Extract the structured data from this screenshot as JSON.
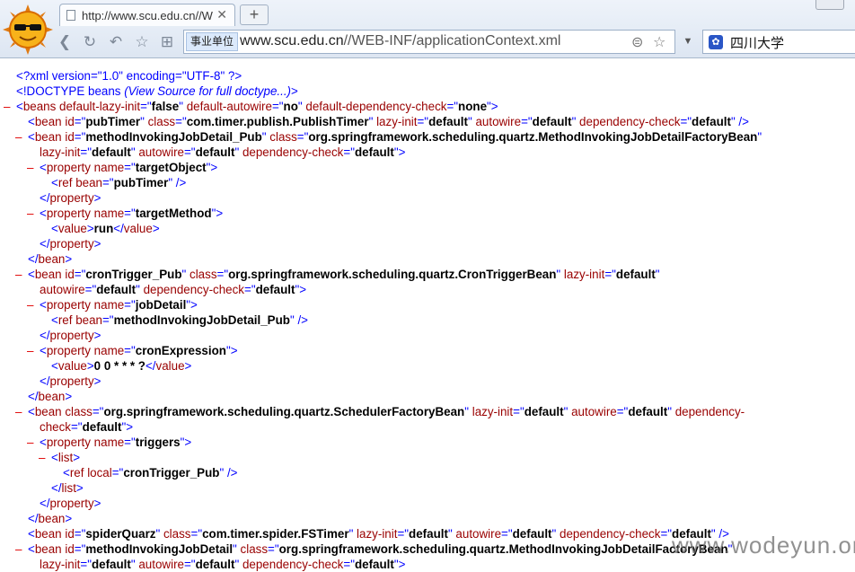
{
  "browser": {
    "tab_title": "http://www.scu.edu.cn//W",
    "tab_close": "✕",
    "new_tab": "+",
    "zone_badge": "事业单位",
    "url_host": "www.scu.edu.cn",
    "url_path": "//WEB-INF/applicationContext.xml",
    "search_text": "四川大学",
    "search_engine_icon": "paw-icon"
  },
  "xml_lines": [
    {
      "indent": 0,
      "parts": [
        [
          "t",
          "<?xml version=\"1.0\" encoding=\"UTF-8\" ?>"
        ]
      ]
    },
    {
      "indent": 0,
      "parts": [
        [
          "t",
          "<!DOCTYPE beans "
        ],
        [
          "dt",
          "(View Source for full doctype...)"
        ],
        [
          "t",
          ">"
        ]
      ]
    },
    {
      "indent": 0,
      "minus": true,
      "parts": [
        [
          "t",
          "<"
        ],
        [
          "tn",
          "beans"
        ],
        [
          "an",
          " default-lazy-init"
        ],
        [
          "t",
          "=\""
        ],
        [
          "av",
          "false"
        ],
        [
          "t",
          "\""
        ],
        [
          "an",
          " default-autowire"
        ],
        [
          "t",
          "=\""
        ],
        [
          "av",
          "no"
        ],
        [
          "t",
          "\""
        ],
        [
          "an",
          " default-dependency-check"
        ],
        [
          "t",
          "=\""
        ],
        [
          "av",
          "none"
        ],
        [
          "t",
          "\">"
        ]
      ]
    },
    {
      "indent": 1,
      "parts": [
        [
          "t",
          "<"
        ],
        [
          "tn",
          "bean"
        ],
        [
          "an",
          " id"
        ],
        [
          "t",
          "=\""
        ],
        [
          "av",
          "pubTimer"
        ],
        [
          "t",
          "\""
        ],
        [
          "an",
          " class"
        ],
        [
          "t",
          "=\""
        ],
        [
          "av",
          "com.timer.publish.PublishTimer"
        ],
        [
          "t",
          "\""
        ],
        [
          "an",
          " lazy-init"
        ],
        [
          "t",
          "=\""
        ],
        [
          "av",
          "default"
        ],
        [
          "t",
          "\""
        ],
        [
          "an",
          " autowire"
        ],
        [
          "t",
          "=\""
        ],
        [
          "av",
          "default"
        ],
        [
          "t",
          "\""
        ],
        [
          "an",
          " dependency-check"
        ],
        [
          "t",
          "=\""
        ],
        [
          "av",
          "default"
        ],
        [
          "t",
          "\" />"
        ]
      ]
    },
    {
      "indent": 1,
      "minus": true,
      "parts": [
        [
          "t",
          "<"
        ],
        [
          "tn",
          "bean"
        ],
        [
          "an",
          " id"
        ],
        [
          "t",
          "=\""
        ],
        [
          "av",
          "methodInvokingJobDetail_Pub"
        ],
        [
          "t",
          "\""
        ],
        [
          "an",
          " class"
        ],
        [
          "t",
          "=\""
        ],
        [
          "av",
          "org.springframework.scheduling.quartz.MethodInvokingJobDetailFactoryBean"
        ],
        [
          "t",
          "\""
        ]
      ]
    },
    {
      "indent": 2,
      "parts": [
        [
          "an",
          "lazy-init"
        ],
        [
          "t",
          "=\""
        ],
        [
          "av",
          "default"
        ],
        [
          "t",
          "\""
        ],
        [
          "an",
          " autowire"
        ],
        [
          "t",
          "=\""
        ],
        [
          "av",
          "default"
        ],
        [
          "t",
          "\""
        ],
        [
          "an",
          " dependency-check"
        ],
        [
          "t",
          "=\""
        ],
        [
          "av",
          "default"
        ],
        [
          "t",
          "\">"
        ]
      ]
    },
    {
      "indent": 2,
      "minus": true,
      "parts": [
        [
          "t",
          "<"
        ],
        [
          "tn",
          "property"
        ],
        [
          "an",
          " name"
        ],
        [
          "t",
          "=\""
        ],
        [
          "av",
          "targetObject"
        ],
        [
          "t",
          "\">"
        ]
      ]
    },
    {
      "indent": 3,
      "parts": [
        [
          "t",
          "<"
        ],
        [
          "tn",
          "ref"
        ],
        [
          "an",
          " bean"
        ],
        [
          "t",
          "=\""
        ],
        [
          "av",
          "pubTimer"
        ],
        [
          "t",
          "\" />"
        ]
      ]
    },
    {
      "indent": 2,
      "parts": [
        [
          "t",
          "</"
        ],
        [
          "tn",
          "property"
        ],
        [
          "t",
          ">"
        ]
      ]
    },
    {
      "indent": 2,
      "minus": true,
      "parts": [
        [
          "t",
          "<"
        ],
        [
          "tn",
          "property"
        ],
        [
          "an",
          " name"
        ],
        [
          "t",
          "=\""
        ],
        [
          "av",
          "targetMethod"
        ],
        [
          "t",
          "\">"
        ]
      ]
    },
    {
      "indent": 3,
      "parts": [
        [
          "t",
          "<"
        ],
        [
          "tn",
          "value"
        ],
        [
          "t",
          ">"
        ],
        [
          "txt",
          "run"
        ],
        [
          "t",
          "</"
        ],
        [
          "tn",
          "value"
        ],
        [
          "t",
          ">"
        ]
      ]
    },
    {
      "indent": 2,
      "parts": [
        [
          "t",
          "</"
        ],
        [
          "tn",
          "property"
        ],
        [
          "t",
          ">"
        ]
      ]
    },
    {
      "indent": 1,
      "parts": [
        [
          "t",
          "</"
        ],
        [
          "tn",
          "bean"
        ],
        [
          "t",
          ">"
        ]
      ]
    },
    {
      "indent": 1,
      "minus": true,
      "parts": [
        [
          "t",
          "<"
        ],
        [
          "tn",
          "bean"
        ],
        [
          "an",
          " id"
        ],
        [
          "t",
          "=\""
        ],
        [
          "av",
          "cronTrigger_Pub"
        ],
        [
          "t",
          "\""
        ],
        [
          "an",
          " class"
        ],
        [
          "t",
          "=\""
        ],
        [
          "av",
          "org.springframework.scheduling.quartz.CronTriggerBean"
        ],
        [
          "t",
          "\""
        ],
        [
          "an",
          " lazy-init"
        ],
        [
          "t",
          "=\""
        ],
        [
          "av",
          "default"
        ],
        [
          "t",
          "\""
        ]
      ]
    },
    {
      "indent": 2,
      "parts": [
        [
          "an",
          "autowire"
        ],
        [
          "t",
          "=\""
        ],
        [
          "av",
          "default"
        ],
        [
          "t",
          "\""
        ],
        [
          "an",
          " dependency-check"
        ],
        [
          "t",
          "=\""
        ],
        [
          "av",
          "default"
        ],
        [
          "t",
          "\">"
        ]
      ]
    },
    {
      "indent": 2,
      "minus": true,
      "parts": [
        [
          "t",
          "<"
        ],
        [
          "tn",
          "property"
        ],
        [
          "an",
          " name"
        ],
        [
          "t",
          "=\""
        ],
        [
          "av",
          "jobDetail"
        ],
        [
          "t",
          "\">"
        ]
      ]
    },
    {
      "indent": 3,
      "parts": [
        [
          "t",
          "<"
        ],
        [
          "tn",
          "ref"
        ],
        [
          "an",
          " bean"
        ],
        [
          "t",
          "=\""
        ],
        [
          "av",
          "methodInvokingJobDetail_Pub"
        ],
        [
          "t",
          "\" />"
        ]
      ]
    },
    {
      "indent": 2,
      "parts": [
        [
          "t",
          "</"
        ],
        [
          "tn",
          "property"
        ],
        [
          "t",
          ">"
        ]
      ]
    },
    {
      "indent": 2,
      "minus": true,
      "parts": [
        [
          "t",
          "<"
        ],
        [
          "tn",
          "property"
        ],
        [
          "an",
          " name"
        ],
        [
          "t",
          "=\""
        ],
        [
          "av",
          "cronExpression"
        ],
        [
          "t",
          "\">"
        ]
      ]
    },
    {
      "indent": 3,
      "parts": [
        [
          "t",
          "<"
        ],
        [
          "tn",
          "value"
        ],
        [
          "t",
          ">"
        ],
        [
          "txt",
          "0 0 * * * ?"
        ],
        [
          "t",
          "</"
        ],
        [
          "tn",
          "value"
        ],
        [
          "t",
          ">"
        ]
      ]
    },
    {
      "indent": 2,
      "parts": [
        [
          "t",
          "</"
        ],
        [
          "tn",
          "property"
        ],
        [
          "t",
          ">"
        ]
      ]
    },
    {
      "indent": 1,
      "parts": [
        [
          "t",
          "</"
        ],
        [
          "tn",
          "bean"
        ],
        [
          "t",
          ">"
        ]
      ]
    },
    {
      "indent": 1,
      "minus": true,
      "parts": [
        [
          "t",
          "<"
        ],
        [
          "tn",
          "bean"
        ],
        [
          "an",
          " class"
        ],
        [
          "t",
          "=\""
        ],
        [
          "av",
          "org.springframework.scheduling.quartz.SchedulerFactoryBean"
        ],
        [
          "t",
          "\""
        ],
        [
          "an",
          " lazy-init"
        ],
        [
          "t",
          "=\""
        ],
        [
          "av",
          "default"
        ],
        [
          "t",
          "\""
        ],
        [
          "an",
          " autowire"
        ],
        [
          "t",
          "=\""
        ],
        [
          "av",
          "default"
        ],
        [
          "t",
          "\""
        ],
        [
          "an",
          " dependency-"
        ]
      ]
    },
    {
      "indent": 2,
      "parts": [
        [
          "an",
          "check"
        ],
        [
          "t",
          "=\""
        ],
        [
          "av",
          "default"
        ],
        [
          "t",
          "\">"
        ]
      ]
    },
    {
      "indent": 2,
      "minus": true,
      "parts": [
        [
          "t",
          "<"
        ],
        [
          "tn",
          "property"
        ],
        [
          "an",
          " name"
        ],
        [
          "t",
          "=\""
        ],
        [
          "av",
          "triggers"
        ],
        [
          "t",
          "\">"
        ]
      ]
    },
    {
      "indent": 3,
      "minus": true,
      "parts": [
        [
          "t",
          "<"
        ],
        [
          "tn",
          "list"
        ],
        [
          "t",
          ">"
        ]
      ]
    },
    {
      "indent": 4,
      "parts": [
        [
          "t",
          "<"
        ],
        [
          "tn",
          "ref"
        ],
        [
          "an",
          " local"
        ],
        [
          "t",
          "=\""
        ],
        [
          "av",
          "cronTrigger_Pub"
        ],
        [
          "t",
          "\" />"
        ]
      ]
    },
    {
      "indent": 3,
      "parts": [
        [
          "t",
          "</"
        ],
        [
          "tn",
          "list"
        ],
        [
          "t",
          ">"
        ]
      ]
    },
    {
      "indent": 2,
      "parts": [
        [
          "t",
          "</"
        ],
        [
          "tn",
          "property"
        ],
        [
          "t",
          ">"
        ]
      ]
    },
    {
      "indent": 1,
      "parts": [
        [
          "t",
          "</"
        ],
        [
          "tn",
          "bean"
        ],
        [
          "t",
          ">"
        ]
      ]
    },
    {
      "indent": 1,
      "parts": [
        [
          "t",
          "<"
        ],
        [
          "tn",
          "bean"
        ],
        [
          "an",
          " id"
        ],
        [
          "t",
          "=\""
        ],
        [
          "av",
          "spiderQuarz"
        ],
        [
          "t",
          "\""
        ],
        [
          "an",
          " class"
        ],
        [
          "t",
          "=\""
        ],
        [
          "av",
          "com.timer.spider.FSTimer"
        ],
        [
          "t",
          "\""
        ],
        [
          "an",
          " lazy-init"
        ],
        [
          "t",
          "=\""
        ],
        [
          "av",
          "default"
        ],
        [
          "t",
          "\""
        ],
        [
          "an",
          " autowire"
        ],
        [
          "t",
          "=\""
        ],
        [
          "av",
          "default"
        ],
        [
          "t",
          "\""
        ],
        [
          "an",
          " dependency-check"
        ],
        [
          "t",
          "=\""
        ],
        [
          "av",
          "default"
        ],
        [
          "t",
          "\" />"
        ]
      ]
    },
    {
      "indent": 1,
      "minus": true,
      "parts": [
        [
          "t",
          "<"
        ],
        [
          "tn",
          "bean"
        ],
        [
          "an",
          " id"
        ],
        [
          "t",
          "=\""
        ],
        [
          "av",
          "methodInvokingJobDetail"
        ],
        [
          "t",
          "\""
        ],
        [
          "an",
          " class"
        ],
        [
          "t",
          "=\""
        ],
        [
          "av",
          "org.springframework.scheduling.quartz.MethodInvokingJobDetailFactoryBean"
        ],
        [
          "t",
          "\""
        ]
      ]
    },
    {
      "indent": 2,
      "parts": [
        [
          "an",
          "lazy-init"
        ],
        [
          "t",
          "=\""
        ],
        [
          "av",
          "default"
        ],
        [
          "t",
          "\""
        ],
        [
          "an",
          " autowire"
        ],
        [
          "t",
          "=\""
        ],
        [
          "av",
          "default"
        ],
        [
          "t",
          "\""
        ],
        [
          "an",
          " dependency-check"
        ],
        [
          "t",
          "=\""
        ],
        [
          "av",
          "default"
        ],
        [
          "t",
          "\">"
        ]
      ]
    }
  ],
  "watermark": "www.wodeyun.org"
}
